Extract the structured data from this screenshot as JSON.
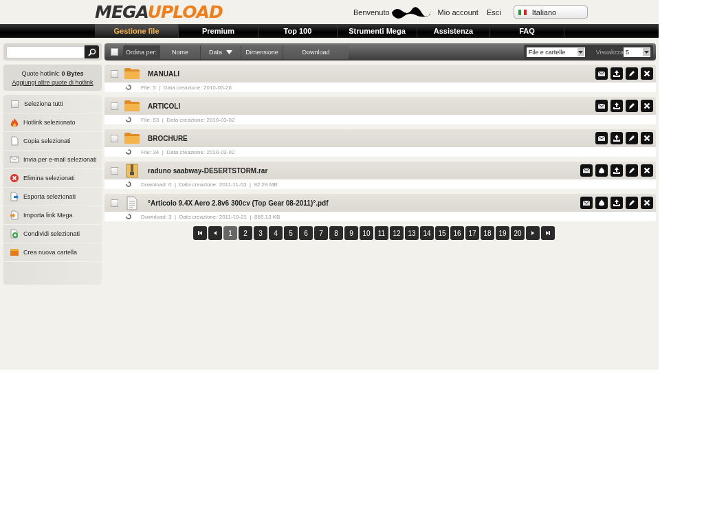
{
  "header": {
    "logo": {
      "first": "MEGA",
      "second": "UPLOAD"
    },
    "welcome": "Benvenuto",
    "links": [
      "Mio account",
      "Esci"
    ],
    "language": "Italiano"
  },
  "nav": [
    {
      "label": "Gestione file",
      "selected": true
    },
    {
      "label": "Premium",
      "selected": false
    },
    {
      "label": "Top 100",
      "selected": false
    },
    {
      "label": "Strumenti Mega",
      "selected": false
    },
    {
      "label": "Assistenza",
      "selected": false
    },
    {
      "label": "FAQ",
      "selected": false
    }
  ],
  "sidebar": {
    "quota_label": "Quote hotlink: **0 Bytes**",
    "quota_link": "Aggiungi altre quote di hotlink",
    "items": [
      {
        "kind": "checkbox",
        "label": "Seleziona tutti",
        "checked": false
      },
      {
        "kind": "fire",
        "label": "Hotlink selezionato"
      },
      {
        "kind": "copy",
        "label": "Copia selezionati"
      },
      {
        "kind": "mail",
        "label": "Invia per e-mail selezionati"
      },
      {
        "kind": "delete",
        "label": "Elimina selezionati"
      },
      {
        "kind": "export",
        "label": "Esporta selezionati"
      },
      {
        "kind": "import",
        "label": "Importa link Mega"
      },
      {
        "kind": "share",
        "label": "Condividi selezionati"
      },
      {
        "kind": "folder",
        "label": "Crea nuova cartella"
      }
    ]
  },
  "toolbar": {
    "select_all": false,
    "sort_label": "Ordina per:",
    "sort_columns": [
      {
        "label": "Nome",
        "sorted": false
      },
      {
        "label": "Data",
        "sorted": true
      },
      {
        "label": "Dimensione",
        "sorted": false
      },
      {
        "label": "Download",
        "sorted": false
      }
    ],
    "filter": "File e cartelle",
    "show_label": "Visualizza",
    "show_count": "5"
  },
  "files": [
    {
      "kind": "folder",
      "name": "MANUALI",
      "meta": "File: 5  |  Data creazione: 2010-05-26",
      "checked": false,
      "actions": [
        {
          "kind": "mail"
        },
        {
          "kind": "download"
        },
        {
          "kind": "edit"
        },
        {
          "kind": "delete"
        }
      ]
    },
    {
      "kind": "folder",
      "name": "ARTICOLI",
      "meta": "File: 53  |  Data creazione: 2010-03-02",
      "checked": false,
      "actions": [
        {
          "kind": "mail"
        },
        {
          "kind": "download"
        },
        {
          "kind": "edit"
        },
        {
          "kind": "delete"
        }
      ]
    },
    {
      "kind": "folder",
      "name": "BROCHURE",
      "meta": "File: 34  |  Data creazione: 2010-03-02",
      "checked": false,
      "actions": [
        {
          "kind": "mail"
        },
        {
          "kind": "download"
        },
        {
          "kind": "edit"
        },
        {
          "kind": "delete"
        }
      ]
    },
    {
      "kind": "archive",
      "name": "raduno saabway-DESERTSTORM.rar",
      "meta": "Download: 0  |  Data creazione: 2011-11-03  |  92.29 MB",
      "checked": false,
      "actions": [
        {
          "kind": "mail"
        },
        {
          "kind": "hotlink"
        },
        {
          "kind": "download"
        },
        {
          "kind": "edit"
        },
        {
          "kind": "delete"
        }
      ]
    },
    {
      "kind": "document",
      "name": "°Articolo 9.4X Aero 2.8v6 300cv (Top Gear 08-2011)°.pdf",
      "meta": "Download: 3  |  Data creazione: 2011-10-21  |  865.13 KB",
      "checked": false,
      "actions": [
        {
          "kind": "mail"
        },
        {
          "kind": "hotlink"
        },
        {
          "kind": "download"
        },
        {
          "kind": "edit"
        },
        {
          "kind": "delete"
        }
      ]
    }
  ],
  "pagination": [
    {
      "label": "1",
      "selected": true
    },
    {
      "label": "2",
      "selected": false
    },
    {
      "label": "3",
      "selected": false
    },
    {
      "label": "4",
      "selected": false
    },
    {
      "label": "5",
      "selected": false
    },
    {
      "label": "6",
      "selected": false
    },
    {
      "label": "7",
      "selected": false
    },
    {
      "label": "8",
      "selected": false
    },
    {
      "label": "9",
      "selected": false
    },
    {
      "label": "10",
      "selected": false
    },
    {
      "label": "11",
      "selected": false
    },
    {
      "label": "12",
      "selected": false
    },
    {
      "label": "13",
      "selected": false
    },
    {
      "label": "14",
      "selected": false
    },
    {
      "label": "15",
      "selected": false
    },
    {
      "label": "16",
      "selected": false
    },
    {
      "label": "17",
      "selected": false
    },
    {
      "label": "18",
      "selected": false
    },
    {
      "label": "19",
      "selected": false
    },
    {
      "label": "20",
      "selected": false
    }
  ]
}
